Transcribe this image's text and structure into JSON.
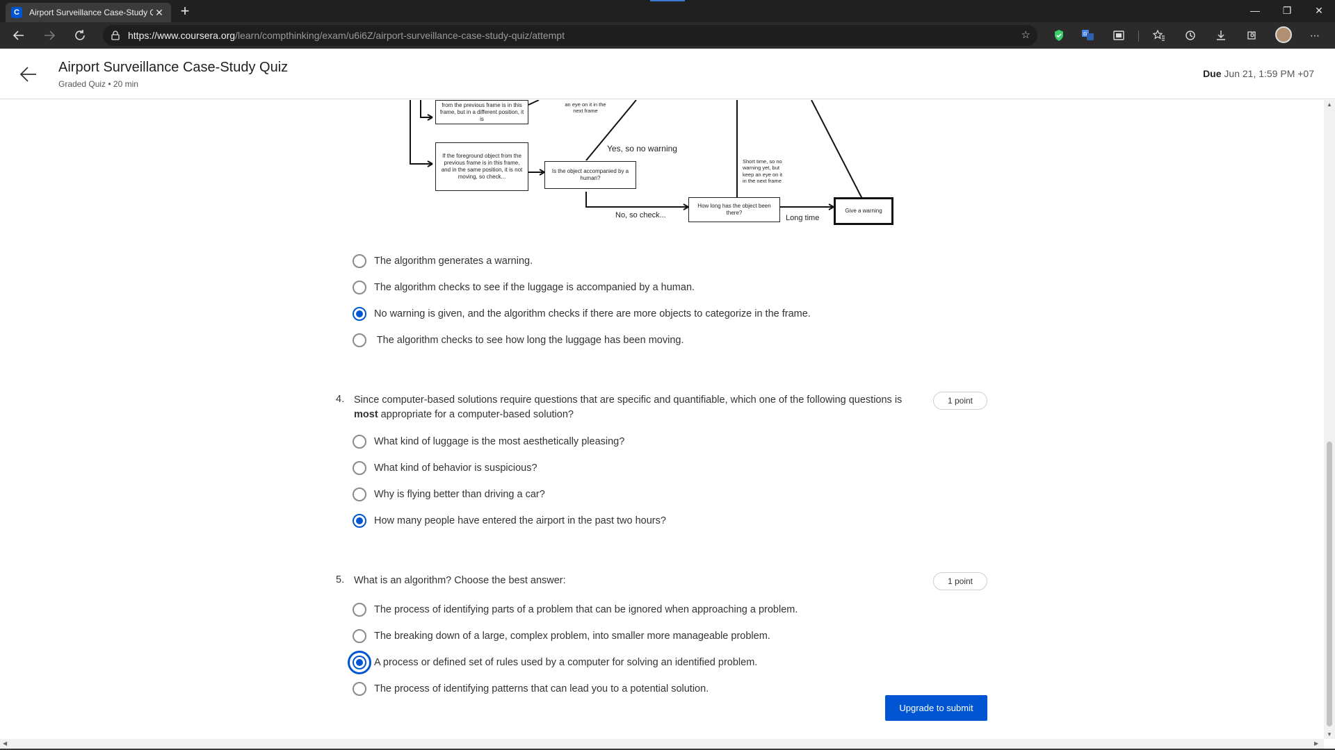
{
  "browser": {
    "tab_title": "Airport Surveillance Case-Study Quiz | Coursera",
    "tab_favicon_letter": "C",
    "url_prefix": "https://",
    "url_host": "www.coursera.org",
    "url_path": "/learn/compthinking/exam/u6i6Z/airport-surveillance-case-study-quiz/attempt",
    "new_tab": "+",
    "minimize": "—",
    "restore": "❐",
    "close": "✕"
  },
  "header": {
    "title": "Airport Surveillance Case-Study Quiz",
    "subtitle": "Graded Quiz • 20 min",
    "due_label": "Due",
    "due_value": "Jun 21, 1:59 PM +07"
  },
  "flowchart": {
    "box_prev_moved": "from the previous frame is in this frame, but in a different position, it is",
    "box_prev_same": "If the foreground object from the previous frame is in this frame, and in the same position, it is not moving, so check...",
    "box_accompanied": "Is the object accompanied by a human?",
    "box_how_long": "How long has the object been there?",
    "box_warning": "Give a warning",
    "label_yes_no_warning": "Yes, so no warning",
    "label_no_check": "No, so check...",
    "label_long_time": "Long time",
    "note_eye_next": "an eye on it in the next frame",
    "note_short_time": "Short time, so no warning yet, but keep an eye on it in the next frame"
  },
  "question3": {
    "options": [
      {
        "text": "The algorithm generates a warning.",
        "selected": false
      },
      {
        "text": "The algorithm checks to see if the luggage is accompanied by a human.",
        "selected": false
      },
      {
        "text": "No warning is given, and the algorithm checks if there are more objects to categorize in the frame.",
        "selected": true
      },
      {
        "text": " The algorithm checks to see how long the luggage has been moving.",
        "selected": false
      }
    ]
  },
  "question4": {
    "number": "4.",
    "text_before": "Since computer-based solutions require questions that are specific and quantifiable, which one of the following questions is ",
    "text_bold": "most",
    "text_after": " appropriate for a computer-based solution?",
    "points": "1 point",
    "options": [
      {
        "text": "What kind of luggage is the most aesthetically pleasing?",
        "selected": false
      },
      {
        "text": "What kind of behavior is suspicious?",
        "selected": false
      },
      {
        "text": "Why is flying better than driving a car?",
        "selected": false
      },
      {
        "text": "How many people have entered the airport in the past two hours?",
        "selected": true
      }
    ]
  },
  "question5": {
    "number": "5.",
    "text": "What is an algorithm? Choose the best answer:",
    "points": "1 point",
    "options": [
      {
        "text": "The process of identifying parts of a problem that can be ignored when approaching a problem.",
        "selected": false
      },
      {
        "text": "The breaking down of a large, complex problem, into smaller more manageable problem.",
        "selected": false
      },
      {
        "text": "A process or defined set of rules used by a computer for solving an identified problem.",
        "selected": true,
        "focused": true
      },
      {
        "text": "The process of identifying patterns that can lead you to a potential solution.",
        "selected": false
      }
    ]
  },
  "submit_button": "Upgrade to submit",
  "colors": {
    "accent": "#0056d2",
    "chrome_dark": "#202020",
    "text": "#333333"
  },
  "icons": [
    "back-arrow-icon",
    "forward-arrow-icon",
    "refresh-icon",
    "lock-icon",
    "favorite-add-icon",
    "shield-extension-icon",
    "translate-extension-icon",
    "screen-extension-icon",
    "favorites-icon",
    "history-icon",
    "download-icon",
    "extensions-icon",
    "more-icon"
  ]
}
